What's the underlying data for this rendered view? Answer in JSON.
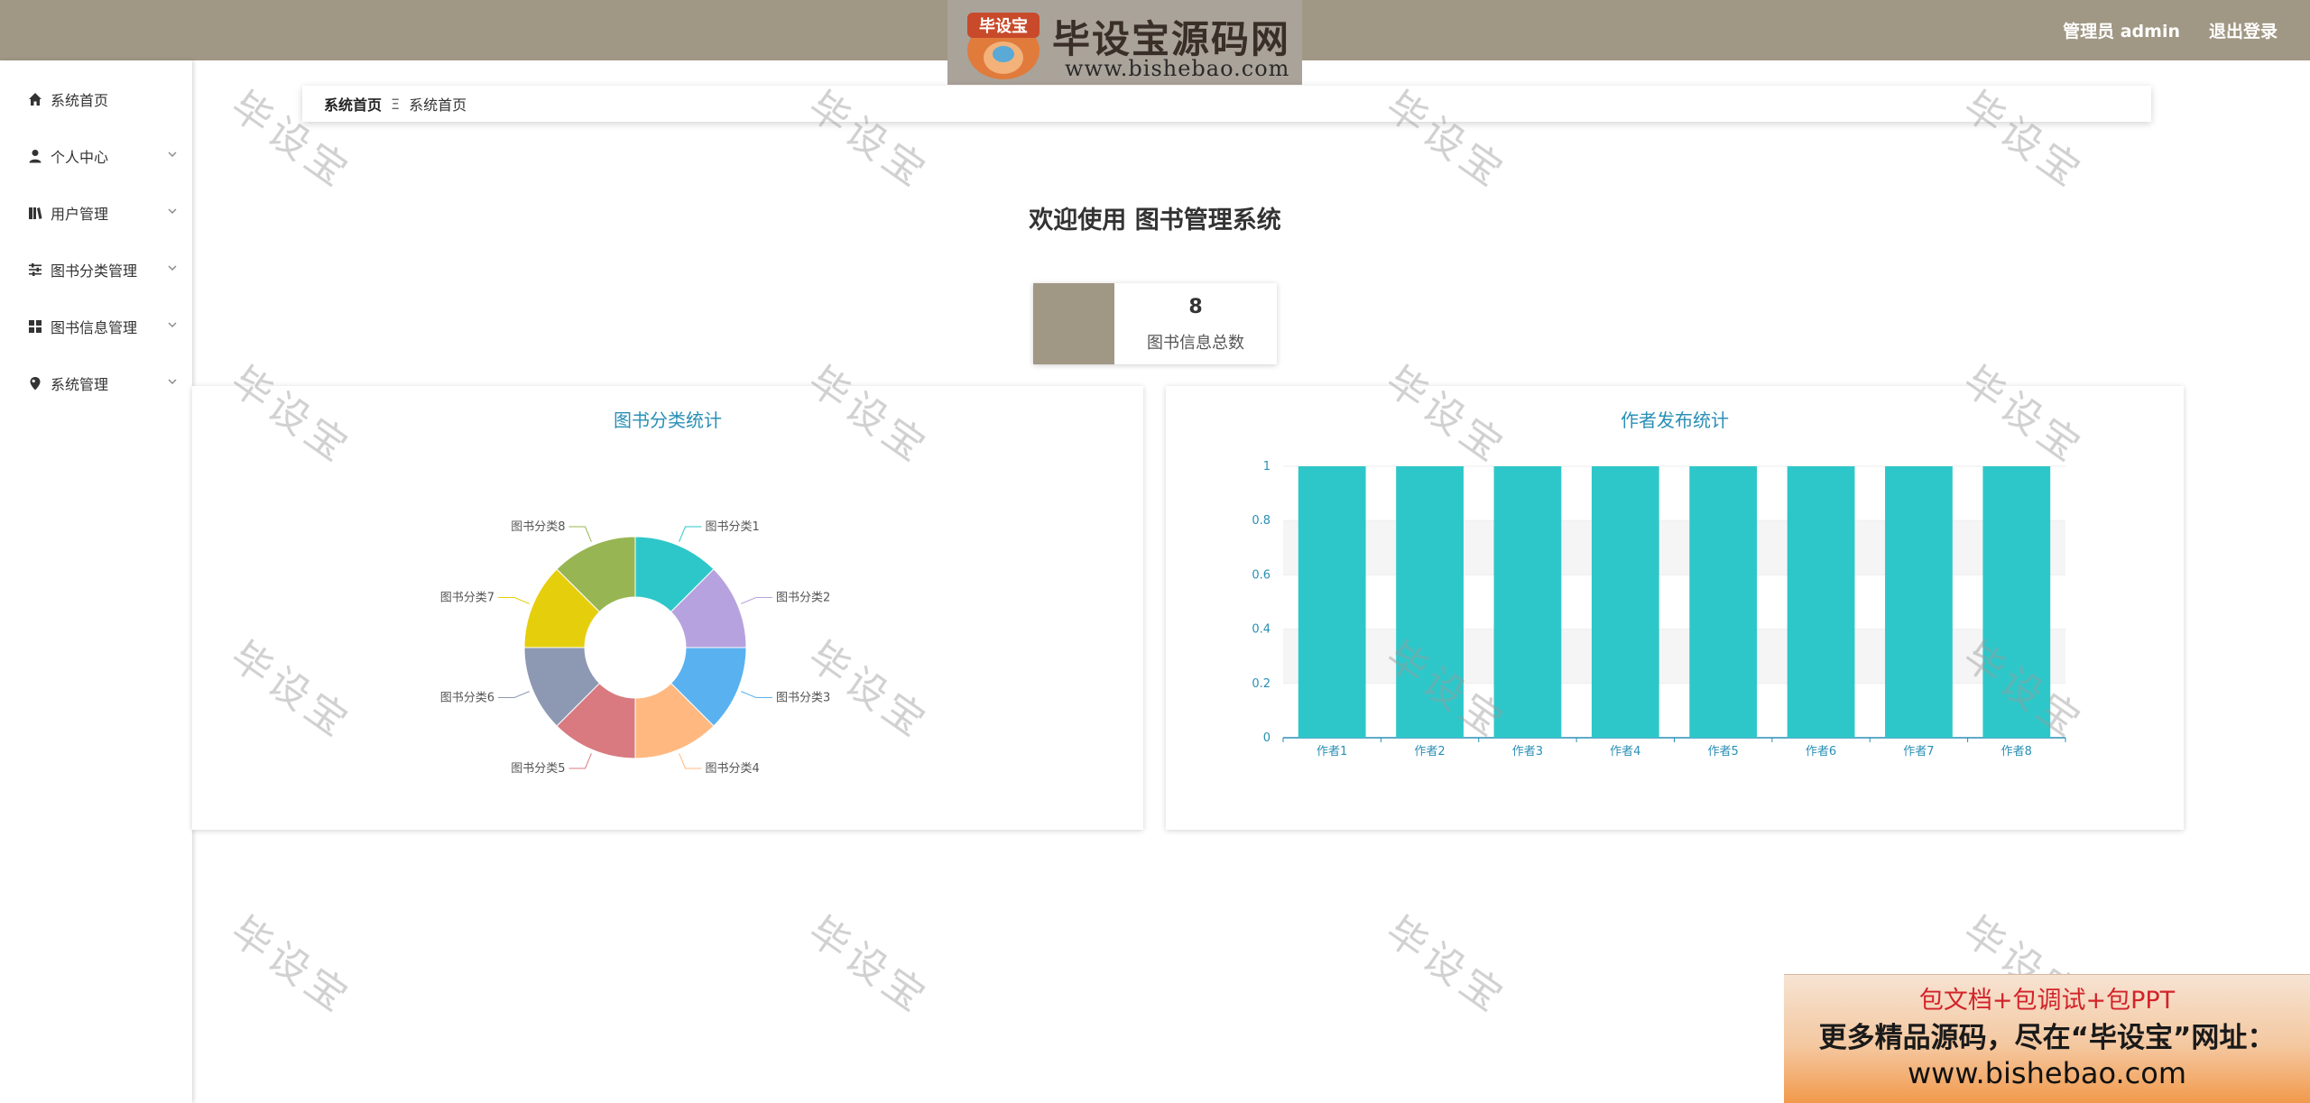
{
  "header": {
    "logo_text": "毕设宝源码网",
    "logo_badge": "毕设宝",
    "logo_url": "www.bishebao.com",
    "admin_label": "管理员 admin",
    "logout_label": "退出登录",
    "bg_color": "#a09784"
  },
  "sidebar": {
    "items": [
      {
        "label": "系统首页",
        "icon": "home-icon",
        "expandable": false
      },
      {
        "label": "个人中心",
        "icon": "user-icon",
        "expandable": true
      },
      {
        "label": "用户管理",
        "icon": "book-icon",
        "expandable": true
      },
      {
        "label": "图书分类管理",
        "icon": "sliders-icon",
        "expandable": true
      },
      {
        "label": "图书信息管理",
        "icon": "grid-icon",
        "expandable": true
      },
      {
        "label": "系统管理",
        "icon": "pin-icon",
        "expandable": true
      }
    ]
  },
  "breadcrumb": {
    "home": "系统首页",
    "separator": "Ξ",
    "current": "系统首页"
  },
  "main": {
    "welcome": "欢迎使用 图书管理系统",
    "stat": {
      "value": "8",
      "label": "图书信息总数"
    }
  },
  "watermark": "毕设宝",
  "ad": {
    "line1": "包文档+包调试+包PPT",
    "line2": "更多精品源码，尽在“毕设宝”网址：",
    "line3": "www.bishebao.com"
  },
  "chart_data": [
    {
      "type": "pie",
      "title": "图书分类统计",
      "donut": true,
      "labels": [
        "图书分类1",
        "图书分类2",
        "图书分类3",
        "图书分类4",
        "图书分类5",
        "图书分类6",
        "图书分类7",
        "图书分类8"
      ],
      "values": [
        1,
        1,
        1,
        1,
        1,
        1,
        1,
        1
      ],
      "colors": [
        "#2ec7c9",
        "#b6a2de",
        "#5ab1ef",
        "#ffb980",
        "#d87a80",
        "#8d98b3",
        "#e5cf0d",
        "#97b552"
      ]
    },
    {
      "type": "bar",
      "title": "作者发布统计",
      "categories": [
        "作者1",
        "作者2",
        "作者3",
        "作者4",
        "作者5",
        "作者6",
        "作者7",
        "作者8"
      ],
      "values": [
        1,
        1,
        1,
        1,
        1,
        1,
        1,
        1
      ],
      "ylim": [
        0,
        1
      ],
      "yticks": [
        "0",
        "0.2",
        "0.4",
        "0.6",
        "0.8",
        "1"
      ],
      "color": "#2ec7c9",
      "axis_color": "#2a8fb5"
    }
  ]
}
